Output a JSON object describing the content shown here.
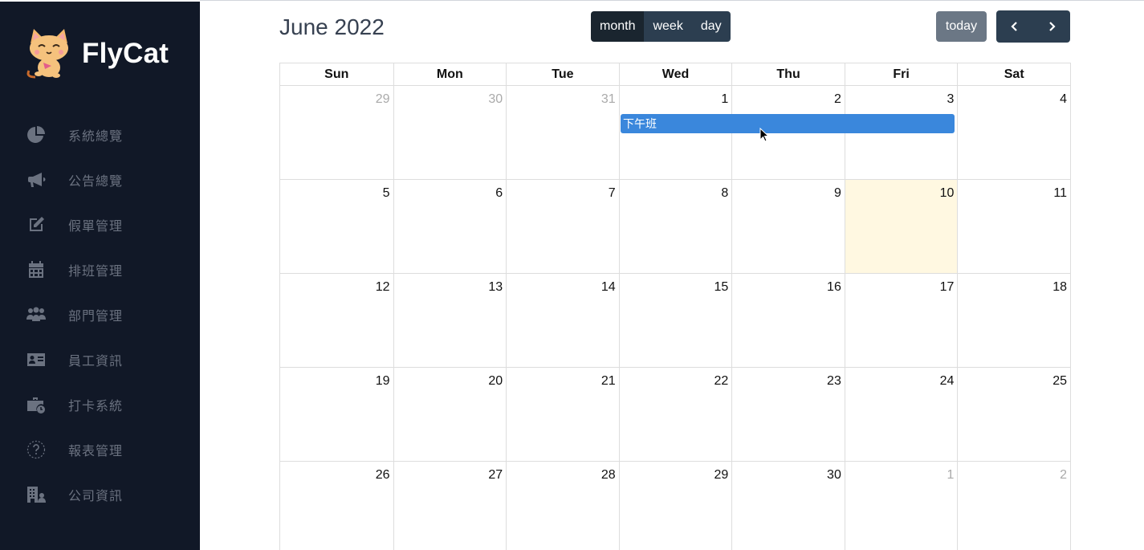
{
  "brand": {
    "name": "FlyCat",
    "logo_icon": "cat-logo-icon"
  },
  "sidebar": {
    "items": [
      {
        "label": "系統總覽",
        "icon": "pie-chart-icon"
      },
      {
        "label": "公告總覽",
        "icon": "megaphone-icon"
      },
      {
        "label": "假單管理",
        "icon": "edit-icon"
      },
      {
        "label": "排班管理",
        "icon": "calendar-icon"
      },
      {
        "label": "部門管理",
        "icon": "users-icon"
      },
      {
        "label": "員工資訊",
        "icon": "id-card-icon"
      },
      {
        "label": "打卡系統",
        "icon": "briefcase-clock-icon"
      },
      {
        "label": "報表管理",
        "icon": "question-circle-icon"
      },
      {
        "label": "公司資訊",
        "icon": "building-user-icon"
      }
    ]
  },
  "calendar": {
    "title": "June 2022",
    "views": [
      "month",
      "week",
      "day"
    ],
    "active_view": "month",
    "today_label": "today",
    "weekdays": [
      "Sun",
      "Mon",
      "Tue",
      "Wed",
      "Thu",
      "Fri",
      "Sat"
    ],
    "weeks": [
      [
        "29",
        "30",
        "31",
        "1",
        "2",
        "3",
        "4"
      ],
      [
        "5",
        "6",
        "7",
        "8",
        "9",
        "10",
        "11"
      ],
      [
        "12",
        "13",
        "14",
        "15",
        "16",
        "17",
        "18"
      ],
      [
        "19",
        "20",
        "21",
        "22",
        "23",
        "24",
        "25"
      ],
      [
        "26",
        "27",
        "28",
        "29",
        "30",
        "1",
        "2"
      ]
    ],
    "today_date": "10",
    "events": [
      {
        "title": "下午班",
        "start": "1",
        "end": "3"
      }
    ]
  },
  "colors": {
    "sidebar_bg": "#111827",
    "accent_button": "#2c3e50",
    "event": "#3a87dc",
    "today_highlight": "#fff8e1"
  }
}
